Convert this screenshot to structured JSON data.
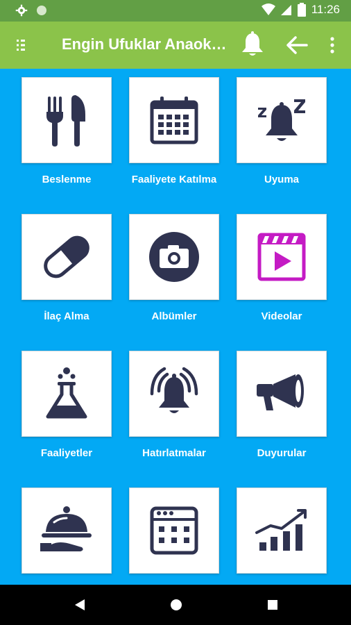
{
  "status_bar": {
    "time": "11:26"
  },
  "app_bar": {
    "title": "Engin Ufuklar Anaokulu"
  },
  "tiles": [
    {
      "label": "Beslenme",
      "icon": "fork-knife-icon"
    },
    {
      "label": "Faaliyete Katılma",
      "icon": "calendar-icon"
    },
    {
      "label": "Uyuma",
      "icon": "sleep-bell-icon"
    },
    {
      "label": "İlaç Alma",
      "icon": "pill-icon"
    },
    {
      "label": "Albümler",
      "icon": "camera-icon"
    },
    {
      "label": "Videolar",
      "icon": "video-icon"
    },
    {
      "label": "Faaliyetler",
      "icon": "flask-icon"
    },
    {
      "label": "Hatırlatmalar",
      "icon": "ringing-bell-icon"
    },
    {
      "label": "Duyurular",
      "icon": "megaphone-icon"
    },
    {
      "label": "",
      "icon": "food-tray-icon"
    },
    {
      "label": "",
      "icon": "calendar-grid-icon"
    },
    {
      "label": "",
      "icon": "chart-icon"
    }
  ],
  "colors": {
    "status_bar": "#629F45",
    "app_bar": "#8BC34A",
    "background": "#03A9F4",
    "icon": "#2F3350",
    "video_icon": "#C41BC4"
  }
}
